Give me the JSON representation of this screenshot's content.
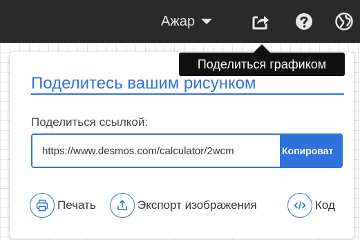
{
  "header": {
    "user_name": "Ажар",
    "icons": [
      "caret-down-icon",
      "share-icon",
      "help-icon",
      "globe-icon"
    ]
  },
  "tooltip": {
    "text": "Поделиться графиком"
  },
  "share_panel": {
    "title": "Поделитесь вашим рисунком",
    "link_label": "Поделиться ссылкой:",
    "link_value": "https://www.desmos.com/calculator/2wcm",
    "copy_label": "Копироват",
    "actions": [
      {
        "label": "Печать",
        "icon": "print-icon"
      },
      {
        "label": "Экспорт изображения",
        "icon": "export-icon"
      },
      {
        "label": "Код",
        "icon": "embed-code-icon"
      }
    ]
  },
  "colors": {
    "accent": "#2f72dc",
    "topbar": "#2a2a2a",
    "tooltip": "#111111"
  }
}
